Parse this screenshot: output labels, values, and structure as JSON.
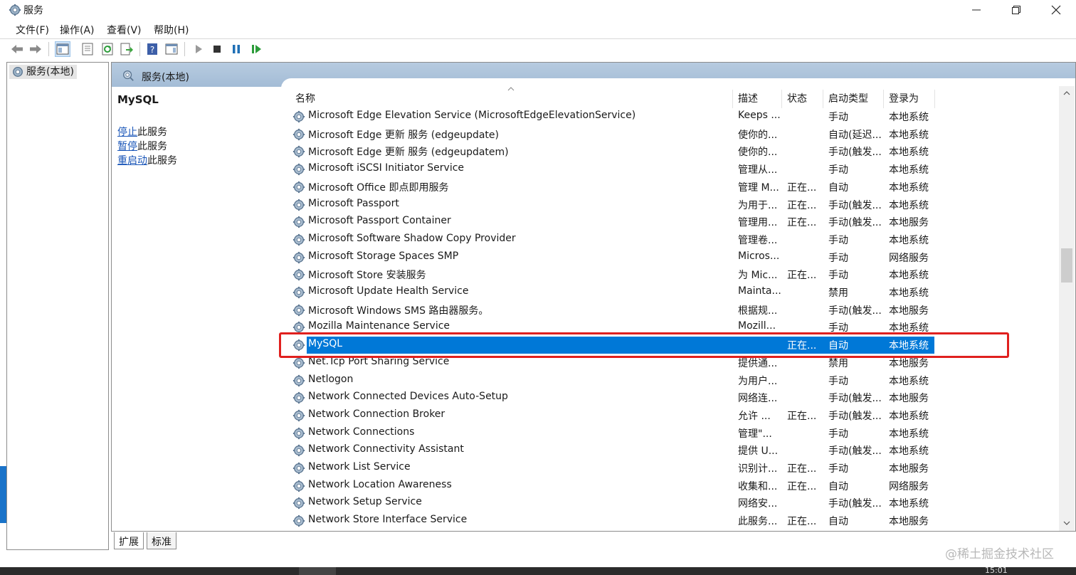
{
  "window": {
    "title": "服务",
    "icon": "gear-icon"
  },
  "menu": [
    "文件(F)",
    "操作(A)",
    "查看(V)",
    "帮助(H)"
  ],
  "toolbar": {
    "icons": [
      "back-arrow-icon",
      "forward-arrow-icon",
      "show-hide-console-tree-icon",
      "properties-icon",
      "refresh-icon",
      "export-list-icon",
      "help-icon",
      "show-action-pane-icon",
      "start-service-icon",
      "stop-service-icon",
      "pause-service-icon",
      "restart-service-icon"
    ]
  },
  "tree": {
    "node_label": "服务(本地)"
  },
  "main": {
    "header_label": "服务(本地)",
    "selected_service": "MySQL",
    "actions": [
      {
        "link": "停止",
        "suffix": "此服务"
      },
      {
        "link": "暂停",
        "suffix": "此服务"
      },
      {
        "link": "重启动",
        "suffix": "此服务"
      }
    ]
  },
  "columns": [
    "名称",
    "描述",
    "状态",
    "启动类型",
    "登录为"
  ],
  "rows": [
    [
      "Microsoft Edge Elevation Service (MicrosoftEdgeElevationService)",
      "Keeps ...",
      "",
      "手动",
      "本地系统"
    ],
    [
      "Microsoft Edge 更新 服务 (edgeupdate)",
      "使你的...",
      "",
      "自动(延迟...",
      "本地系统"
    ],
    [
      "Microsoft Edge 更新 服务 (edgeupdatem)",
      "使你的...",
      "",
      "手动(触发...",
      "本地系统"
    ],
    [
      "Microsoft iSCSI Initiator Service",
      "管理从...",
      "",
      "手动",
      "本地系统"
    ],
    [
      "Microsoft Office 即点即用服务",
      "管理 M...",
      "正在...",
      "自动",
      "本地系统"
    ],
    [
      "Microsoft Passport",
      "为用于...",
      "正在...",
      "手动(触发...",
      "本地系统"
    ],
    [
      "Microsoft Passport Container",
      "管理用...",
      "正在...",
      "手动(触发...",
      "本地服务"
    ],
    [
      "Microsoft Software Shadow Copy Provider",
      "管理卷...",
      "",
      "手动",
      "本地系统"
    ],
    [
      "Microsoft Storage Spaces SMP",
      "Micros...",
      "",
      "手动",
      "网络服务"
    ],
    [
      "Microsoft Store 安装服务",
      "为 Mic...",
      "正在...",
      "手动",
      "本地系统"
    ],
    [
      "Microsoft Update Health Service",
      "Mainta...",
      "",
      "禁用",
      "本地系统"
    ],
    [
      "Microsoft Windows SMS 路由器服务。",
      "根据规...",
      "",
      "手动(触发...",
      "本地服务"
    ],
    [
      "Mozilla Maintenance Service",
      "Mozill...",
      "",
      "手动",
      "本地系统"
    ],
    [
      "MySQL",
      "",
      "正在...",
      "自动",
      "本地系统"
    ],
    [
      "Net.Tcp Port Sharing Service",
      "提供通...",
      "",
      "禁用",
      "本地服务"
    ],
    [
      "Netlogon",
      "为用户...",
      "",
      "手动",
      "本地系统"
    ],
    [
      "Network Connected Devices Auto-Setup",
      "网络连...",
      "",
      "手动(触发...",
      "本地服务"
    ],
    [
      "Network Connection Broker",
      "允许 ...",
      "正在...",
      "手动(触发...",
      "本地系统"
    ],
    [
      "Network Connections",
      "管理\"...",
      "",
      "手动",
      "本地系统"
    ],
    [
      "Network Connectivity Assistant",
      "提供 U...",
      "",
      "手动(触发...",
      "本地系统"
    ],
    [
      "Network List Service",
      "识别计...",
      "正在...",
      "手动",
      "本地服务"
    ],
    [
      "Network Location Awareness",
      "收集和...",
      "正在...",
      "自动",
      "网络服务"
    ],
    [
      "Network Setup Service",
      "网络安...",
      "",
      "手动(触发...",
      "本地系统"
    ],
    [
      "Network Store Interface Service",
      "此服务...",
      "正在...",
      "自动",
      "本地服务"
    ]
  ],
  "selected_row_index": 13,
  "tabs": [
    "扩展",
    "标准"
  ],
  "active_tab": "扩展",
  "watermark": "@稀土掘金技术社区",
  "taskbar_time": "15:01",
  "colors": {
    "selection": "#0078d7",
    "highlight_box": "#e0201e",
    "header": "#a9c0d9"
  }
}
